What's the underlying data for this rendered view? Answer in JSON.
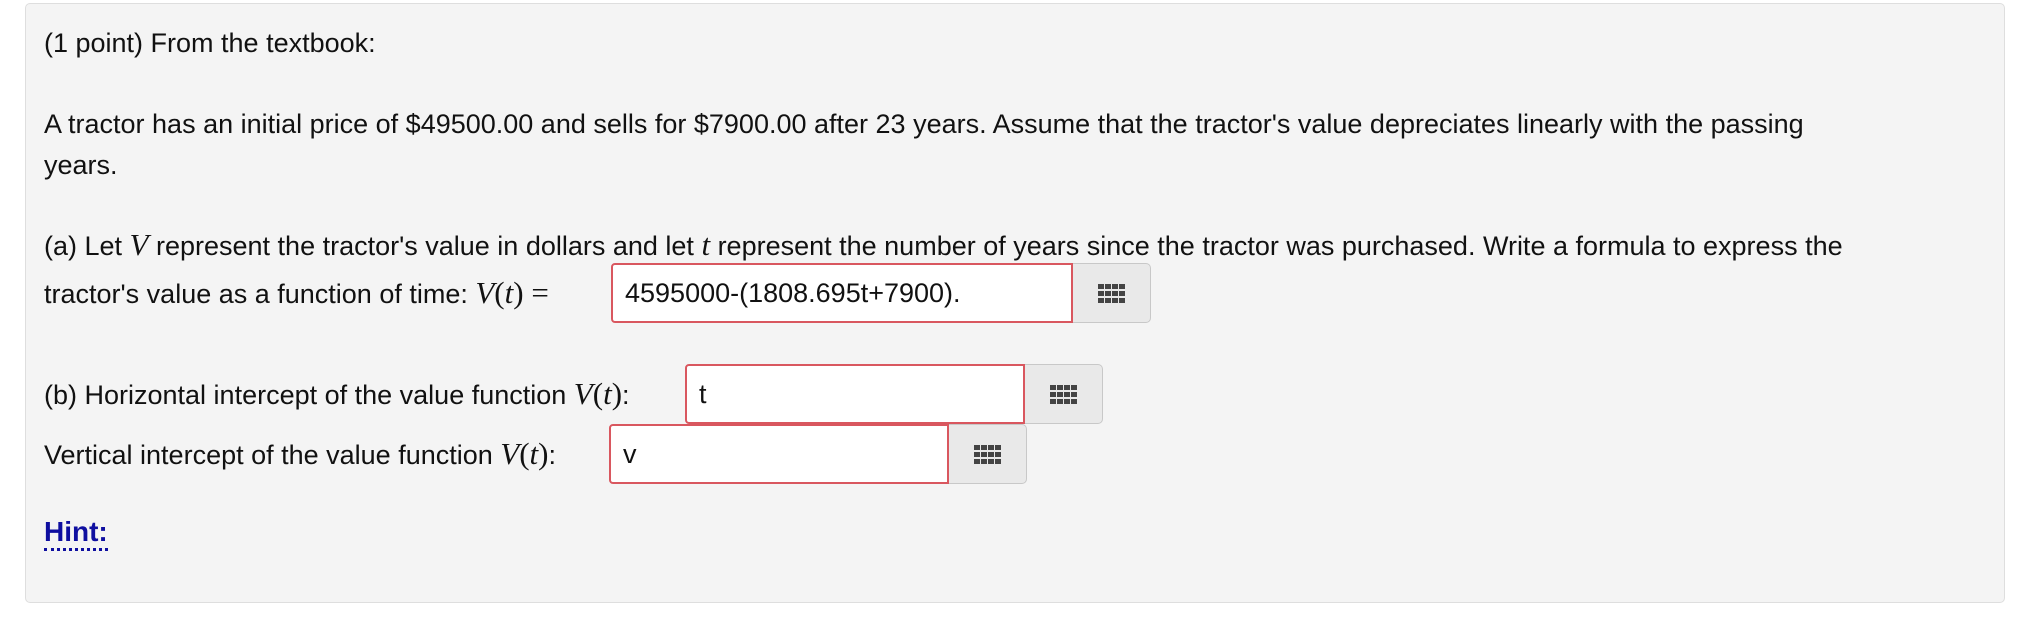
{
  "problem": {
    "header": "(1 point) From the textbook:",
    "statement_line1": "A tractor has an initial price of $49500.00 and sells for $7900.00 after 23 years. Assume that the tractor's value depreciates linearly with the passing",
    "statement_line2": "years.",
    "part_a": {
      "text_1": "(a) Let ",
      "var_V": "V",
      "text_2": " represent the tractor's value in dollars and let ",
      "var_t": "t",
      "text_3": " represent the number of years since the tractor was purchased. Write a formula to express the",
      "text_4": "tractor's value as a function of time: ",
      "function": "V",
      "paren_open": "(",
      "arg": "t",
      "paren_close": ")",
      "equals": " =",
      "answer_value": "4595000-(1808.695t+7900)."
    },
    "part_b": {
      "horizontal_label": "(b) Horizontal intercept of the value function ",
      "horizontal_colon": ":",
      "horizontal_value": "t",
      "vertical_label": "Vertical intercept of the value function ",
      "vertical_colon": ":",
      "vertical_value": "v",
      "function": "V",
      "paren_open": "(",
      "arg": "t",
      "paren_close": ")"
    },
    "hint_label": "Hint:",
    "palette_icon": "grid-icon",
    "colors": {
      "input_error_border": "#d9575f",
      "hint_link": "#0f0fa0",
      "box_background": "#f4f4f4"
    }
  }
}
